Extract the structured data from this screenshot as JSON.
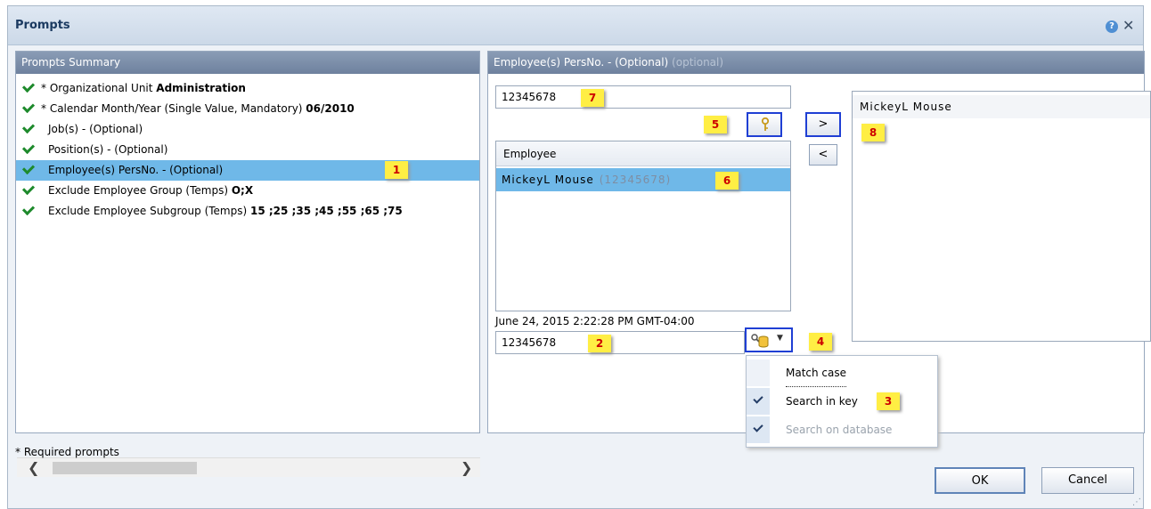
{
  "dialog": {
    "title": "Prompts",
    "help_glyph": "?",
    "close_glyph": "✕"
  },
  "summary": {
    "header": "Prompts Summary",
    "rows": [
      {
        "prefix": "* Organizational Unit ",
        "value": "Administration"
      },
      {
        "prefix": "* Calendar Month/Year (Single Value, Mandatory) ",
        "value": "06/2010"
      },
      {
        "prefix": "Job(s) - (Optional)",
        "value": ""
      },
      {
        "prefix": "Position(s) - (Optional)",
        "value": ""
      },
      {
        "prefix": "Employee(s) PersNo. - (Optional)",
        "value": ""
      },
      {
        "prefix": "Exclude Employee Group (Temps) ",
        "value": "O;X"
      },
      {
        "prefix": "Exclude Employee Subgroup (Temps) ",
        "value": "15 ;25 ;35 ;45 ;55 ;65 ;75"
      }
    ],
    "selected_index": 4
  },
  "detail": {
    "header": "Employee(s) PersNo. - (Optional)",
    "header_faint": "(optional)",
    "key_input_value": "12345678",
    "list_header": "Employee",
    "list_items": [
      {
        "name": "MickeyL Mouse",
        "key": "(12345678)"
      }
    ],
    "timestamp": "June 24, 2015 2:22:28 PM GMT-04:00",
    "search_value": "12345678",
    "add_label": ">",
    "remove_label": "<",
    "selected_values": [
      "MickeyL Mouse"
    ]
  },
  "search_menu": {
    "items": [
      {
        "label": "Match case",
        "checked": false,
        "disabled": false
      },
      {
        "label": "Search in key",
        "checked": true,
        "disabled": false
      },
      {
        "label": "Search on database",
        "checked": true,
        "disabled": true
      }
    ]
  },
  "markers": [
    "1",
    "2",
    "3",
    "4",
    "5",
    "6",
    "7",
    "8"
  ],
  "scroll": {
    "left": "❮",
    "right": "❯"
  },
  "footer": {
    "required_note": "* Required prompts",
    "ok_label": "OK",
    "cancel_label": "Cancel"
  },
  "colors": {
    "selection": "#6fb8e8",
    "marker_bg": "#ffee44",
    "marker_text": "#cc0000",
    "check": "#1e8a2c"
  }
}
